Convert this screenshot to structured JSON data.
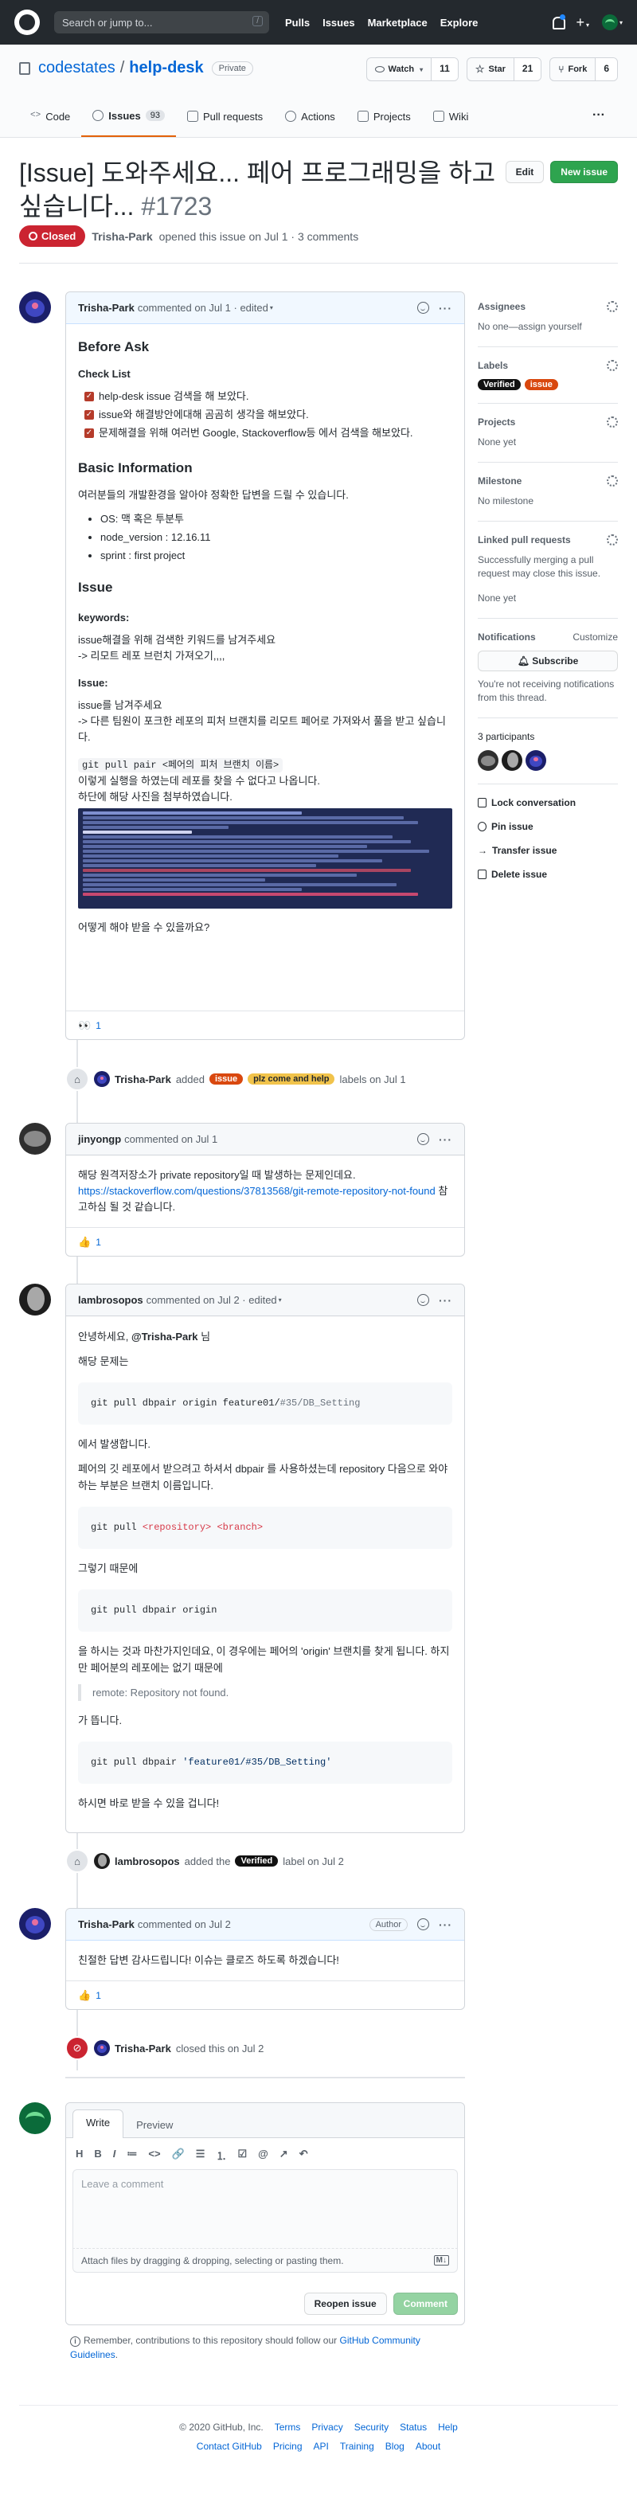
{
  "header": {
    "search_placeholder": "Search or jump to...",
    "search_shortcut": "/",
    "nav": [
      "Pulls",
      "Issues",
      "Marketplace",
      "Explore"
    ]
  },
  "repo": {
    "owner": "codestates",
    "name": "help-desk",
    "visibility": "Private",
    "watch_label": "Watch",
    "watch_count": "11",
    "star_label": "Star",
    "star_count": "21",
    "fork_label": "Fork",
    "fork_count": "6"
  },
  "tabs": [
    {
      "label": "Code"
    },
    {
      "label": "Issues",
      "count": "93"
    },
    {
      "label": "Pull requests"
    },
    {
      "label": "Actions"
    },
    {
      "label": "Projects"
    },
    {
      "label": "Wiki"
    }
  ],
  "issue": {
    "title": "[Issue] 도와주세요... 페어 프로그래밍을 하고 싶습니다...",
    "number": "#1723",
    "edit_label": "Edit",
    "new_issue_label": "New issue",
    "state": "Closed",
    "author": "Trisha-Park",
    "meta": "opened this issue on Jul 1 · 3 comments"
  },
  "comments": [
    {
      "author": "Trisha-Park",
      "meta": "commented on Jul 1 · edited",
      "h_before_ask": "Before Ask",
      "h_checklist": "Check List",
      "tasks": [
        "help-desk issue 검색을 해 보았다.",
        "issue와 해결방안에대해 곰곰히 생각을 해보았다.",
        "문제해결을 위해 여러번 Google, Stackoverflow등 에서 검색을 해보았다."
      ],
      "h_basic": "Basic Information",
      "basic_intro": "여러분들의 개발환경을 알아야 정확한 답변을 드릴 수 있습니다.",
      "basic_items": [
        "OS: 맥 혹은 투분투",
        "node_version : 12.16.11",
        "sprint : first project"
      ],
      "h_issue": "Issue",
      "kw_label": "keywords:",
      "kw_line1": "issue해결을 위해 검색한 키워드를 남겨주세요",
      "kw_line2": "-> 리모트 레포 브런치 가져오기,,,,",
      "issue_label": "Issue:",
      "issue_line1": "issue를 남겨주세요",
      "issue_line2": "-> 다른 팀원이 포크한 레포의 피처 브랜치를 리모트 페어로 가져와서 풀을 받고 싶습니다.",
      "code_inline": "git pull pair <페어의 피처 브랜치 이름>",
      "after_code1": "이렇게 실행을 하였는데 레포를 찾을 수 없다고 나옵니다.",
      "after_code2": "하단에 해당 사진을 첨부하였습니다.",
      "question": "어떻게 해야 받을 수 있을까요?",
      "reaction_emoji": "👀",
      "reaction_count": "1"
    },
    {
      "author": "jinyongp",
      "meta": "commented on Jul 1",
      "line1": "해당 원격저장소가 private repository일 때 발생하는 문제인데요.",
      "link": "https://stackoverflow.com/questions/37813568/git-remote-repository-not-found",
      "link_suffix": " 참고하심 될 것 같습니다.",
      "reaction_emoji": "👍",
      "reaction_count": "1"
    },
    {
      "author": "lambrosopos",
      "meta": "commented on Jul 2 · edited",
      "greeting_pre": "안녕하세요, ",
      "mention": "@Trisha-Park",
      "greeting_post": " 님",
      "p1": "해당 문제는",
      "code1_prefix": "git pull dbpair origin feature01/",
      "code1_suffix": "#35/DB_Setting",
      "p2": "에서 발생합니다.",
      "p3": "페어의 깃 레포에서 받으려고 하셔서 dbpair 를 사용하셨는데 repository 다음으로 와야 하는 부분은 브랜치 이름입니다.",
      "code2_prefix": "git pull ",
      "code2_arg1": "<repository>",
      "code2_arg2": "<branch>",
      "p4": "그렇기 때문에",
      "code3": "git pull dbpair origin",
      "p5": "을 하시는 것과 마찬가지인데요, 이 경우에는 페어의 'origin' 브랜치를 찾게 됩니다. 하지만 페어분의 레포에는 없기 때문에",
      "quote": "remote: Repository not found.",
      "p6": "가 뜹니다.",
      "code4_prefix": "git pull dbpair ",
      "code4_str": "'feature01/#35/DB_Setting'",
      "p7": "하시면 바로 받을 수 있을 겁니다!"
    },
    {
      "author": "Trisha-Park",
      "meta": "commented on Jul 2",
      "badge": "Author",
      "body": "친절한 답변 감사드립니다! 이슈는 클로즈 하도록 하겠습니다!",
      "reaction_emoji": "👍",
      "reaction_count": "1"
    }
  ],
  "events": {
    "labels_added": {
      "actor": "Trisha-Park",
      "verb": "added",
      "labels": [
        "issue",
        "plz come and help"
      ],
      "suffix": "labels on Jul 1"
    },
    "verified_added": {
      "actor": "lambrosopos",
      "verb": "added the",
      "label": "Verified",
      "suffix": "label on Jul 2"
    },
    "closed": {
      "actor": "Trisha-Park",
      "suffix": "closed this on Jul 2"
    }
  },
  "sidebar": {
    "assignees_title": "Assignees",
    "assignees_text": "No one—assign yourself",
    "labels_title": "Labels",
    "labels": [
      "Verified",
      "issue"
    ],
    "projects_title": "Projects",
    "projects_text": "None yet",
    "milestone_title": "Milestone",
    "milestone_text": "No milestone",
    "linked_title": "Linked pull requests",
    "linked_text": "Successfully merging a pull request may close this issue.",
    "linked_none": "None yet",
    "notif_title": "Notifications",
    "notif_customize": "Customize",
    "subscribe_label": "Subscribe",
    "notif_text": "You're not receiving notifications from this thread.",
    "participants_title": "3 participants",
    "actions": [
      "Lock conversation",
      "Pin issue",
      "Transfer issue",
      "Delete issue"
    ]
  },
  "composer": {
    "tab_write": "Write",
    "tab_preview": "Preview",
    "toolbar": [
      "H",
      "B",
      "I",
      "≔",
      "<>",
      "🔗",
      "☰",
      "⒈",
      "☑",
      "@",
      "↗",
      "↶"
    ],
    "placeholder": "Leave a comment",
    "attach_text": "Attach files by dragging & dropping, selecting or pasting them.",
    "reopen_label": "Reopen issue",
    "comment_label": "Comment"
  },
  "remember": {
    "text": "Remember, contributions to this repository should follow our ",
    "link": "GitHub Community Guidelines",
    "end": "."
  },
  "footer": {
    "copyright": "© 2020 GitHub, Inc.",
    "row1": [
      "Terms",
      "Privacy",
      "Security",
      "Status",
      "Help"
    ],
    "row2": [
      "Contact GitHub",
      "Pricing",
      "API",
      "Training",
      "Blog",
      "About"
    ]
  },
  "colors": {
    "accent": "#0366d6",
    "closed": "#cb2431",
    "green": "#2ea44f",
    "header_bg": "#24292e"
  }
}
